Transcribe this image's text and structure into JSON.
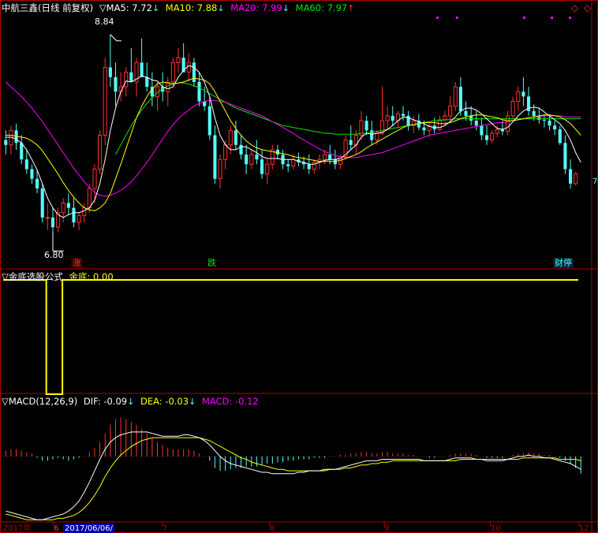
{
  "header": {
    "stock_name": "中航三鑫",
    "period": "(日线 前复权)",
    "ma_indicator": "▽MA5: 7.72",
    "ma5_arrow": "↓",
    "ma10": "MA10: 7.88",
    "ma10_arrow": "↓",
    "ma20": "MA20: 7.99",
    "ma20_arrow": "↓",
    "ma60": "MA60: 7.97",
    "ma60_arrow": "↑"
  },
  "indicator_panel": {
    "title": "▽金底选股公式",
    "label": "金底: 0.00"
  },
  "macd_panel": {
    "title": "▽MACD(12,26,9)",
    "dif": "DIF: -0.09",
    "dif_arrow": "↓",
    "dea": "DEA: -0.03",
    "dea_arrow": "↓",
    "macd": "MACD: -0.12"
  },
  "annotations": {
    "high_label": "8.84",
    "low_label": "6.80",
    "tag_rise": "涨",
    "tag_fall": "跌",
    "tag_finance": "财停"
  },
  "axis": {
    "x_labels": [
      "2017年",
      "6",
      "2017/06/06/",
      "7",
      "8",
      "9",
      "10",
      "12"
    ],
    "right_marker": "7"
  },
  "colors": {
    "up": "#ff3232",
    "down": "#54fcfc",
    "ma5": "#ffffff",
    "ma10": "#ffff00",
    "ma20": "#ff00ff",
    "ma60": "#00e600",
    "dif": "#ffffff",
    "dea": "#ffff00",
    "grid": "#b00000"
  },
  "chart_data": {
    "type": "candlestick",
    "price_range": [
      6.55,
      9.05
    ],
    "candles": [
      [
        7.75,
        7.85,
        7.6,
        7.7
      ],
      [
        7.7,
        7.9,
        7.6,
        7.85
      ],
      [
        7.85,
        7.92,
        7.65,
        7.72
      ],
      [
        7.72,
        7.8,
        7.5,
        7.55
      ],
      [
        7.55,
        7.65,
        7.4,
        7.45
      ],
      [
        7.45,
        7.5,
        7.3,
        7.35
      ],
      [
        7.35,
        7.45,
        7.2,
        7.25
      ],
      [
        7.25,
        7.3,
        6.9,
        6.95
      ],
      [
        6.95,
        7.1,
        6.82,
        6.95
      ],
      [
        6.95,
        7.05,
        6.8,
        6.85
      ],
      [
        6.85,
        7.05,
        6.8,
        7.0
      ],
      [
        7.0,
        7.15,
        6.9,
        7.1
      ],
      [
        7.1,
        7.2,
        6.98,
        7.05
      ],
      [
        7.05,
        7.15,
        6.85,
        6.9
      ],
      [
        6.9,
        7.0,
        6.82,
        6.97
      ],
      [
        6.97,
        7.1,
        6.9,
        7.05
      ],
      [
        7.05,
        7.3,
        7.0,
        7.25
      ],
      [
        7.25,
        7.5,
        7.1,
        7.45
      ],
      [
        7.45,
        7.85,
        7.4,
        7.8
      ],
      [
        7.8,
        8.6,
        7.7,
        8.5
      ],
      [
        8.5,
        8.84,
        8.3,
        8.4
      ],
      [
        8.4,
        8.55,
        8.1,
        8.25
      ],
      [
        8.25,
        8.45,
        8.15,
        8.3
      ],
      [
        8.3,
        8.5,
        8.2,
        8.45
      ],
      [
        8.45,
        8.7,
        8.4,
        8.35
      ],
      [
        8.35,
        8.6,
        8.2,
        8.55
      ],
      [
        8.55,
        8.8,
        8.45,
        8.4
      ],
      [
        8.4,
        8.55,
        8.25,
        8.3
      ],
      [
        8.3,
        8.45,
        8.1,
        8.2
      ],
      [
        8.2,
        8.35,
        8.05,
        8.3
      ],
      [
        8.3,
        8.45,
        8.15,
        8.25
      ],
      [
        8.25,
        8.4,
        8.1,
        8.35
      ],
      [
        8.35,
        8.6,
        8.3,
        8.55
      ],
      [
        8.55,
        8.7,
        8.45,
        8.6
      ],
      [
        8.6,
        8.75,
        8.5,
        8.45
      ],
      [
        8.45,
        8.65,
        8.35,
        8.55
      ],
      [
        8.55,
        8.6,
        8.3,
        8.35
      ],
      [
        8.35,
        8.45,
        8.1,
        8.15
      ],
      [
        8.15,
        8.3,
        8.05,
        8.1
      ],
      [
        8.1,
        8.2,
        7.75,
        7.8
      ],
      [
        7.8,
        7.9,
        7.3,
        7.35
      ],
      [
        7.35,
        7.6,
        7.25,
        7.55
      ],
      [
        7.55,
        7.75,
        7.45,
        7.7
      ],
      [
        7.7,
        7.9,
        7.6,
        7.85
      ],
      [
        7.85,
        7.95,
        7.65,
        7.7
      ],
      [
        7.7,
        7.8,
        7.55,
        7.6
      ],
      [
        7.6,
        7.7,
        7.4,
        7.5
      ],
      [
        7.5,
        7.65,
        7.45,
        7.6
      ],
      [
        7.6,
        7.75,
        7.5,
        7.55
      ],
      [
        7.55,
        7.65,
        7.35,
        7.4
      ],
      [
        7.4,
        7.55,
        7.3,
        7.5
      ],
      [
        7.5,
        7.7,
        7.45,
        7.65
      ],
      [
        7.65,
        7.7,
        7.55,
        7.6
      ],
      [
        7.6,
        7.65,
        7.45,
        7.5
      ],
      [
        7.5,
        7.55,
        7.42,
        7.48
      ],
      [
        7.48,
        7.6,
        7.45,
        7.55
      ],
      [
        7.55,
        7.62,
        7.48,
        7.52
      ],
      [
        7.52,
        7.58,
        7.45,
        7.5
      ],
      [
        7.5,
        7.6,
        7.4,
        7.45
      ],
      [
        7.45,
        7.55,
        7.4,
        7.52
      ],
      [
        7.52,
        7.6,
        7.45,
        7.55
      ],
      [
        7.55,
        7.65,
        7.5,
        7.6
      ],
      [
        7.6,
        7.7,
        7.5,
        7.55
      ],
      [
        7.55,
        7.65,
        7.45,
        7.5
      ],
      [
        7.5,
        7.6,
        7.45,
        7.58
      ],
      [
        7.58,
        7.8,
        7.55,
        7.75
      ],
      [
        7.75,
        7.9,
        7.65,
        7.7
      ],
      [
        7.7,
        7.85,
        7.6,
        7.8
      ],
      [
        7.8,
        8.05,
        7.75,
        7.95
      ],
      [
        7.95,
        8.0,
        7.8,
        7.85
      ],
      [
        7.85,
        7.95,
        7.7,
        7.75
      ],
      [
        7.75,
        7.85,
        7.7,
        7.82
      ],
      [
        7.82,
        8.3,
        7.8,
        7.95
      ],
      [
        7.95,
        8.1,
        7.85,
        8.0
      ],
      [
        8.0,
        8.1,
        7.9,
        7.95
      ],
      [
        7.95,
        8.05,
        7.88,
        8.02
      ],
      [
        8.02,
        8.1,
        7.95,
        8.0
      ],
      [
        8.0,
        8.05,
        7.85,
        7.9
      ],
      [
        7.9,
        8.0,
        7.82,
        7.95
      ],
      [
        7.95,
        8.02,
        7.85,
        7.88
      ],
      [
        7.88,
        7.95,
        7.8,
        7.85
      ],
      [
        7.85,
        7.92,
        7.78,
        7.9
      ],
      [
        7.9,
        7.98,
        7.82,
        7.86
      ],
      [
        7.86,
        8.0,
        7.84,
        7.96
      ],
      [
        7.96,
        8.05,
        7.9,
        8.0
      ],
      [
        8.0,
        8.2,
        7.95,
        8.1
      ],
      [
        8.1,
        8.35,
        8.05,
        8.3
      ],
      [
        8.3,
        8.4,
        8.0,
        8.05
      ],
      [
        8.05,
        8.15,
        7.95,
        8.0
      ],
      [
        8.0,
        8.1,
        7.9,
        7.95
      ],
      [
        7.95,
        8.05,
        7.85,
        7.9
      ],
      [
        7.9,
        7.98,
        7.75,
        7.8
      ],
      [
        7.8,
        7.9,
        7.7,
        7.75
      ],
      [
        7.75,
        7.85,
        7.72,
        7.82
      ],
      [
        7.82,
        7.9,
        7.78,
        7.86
      ],
      [
        7.86,
        7.95,
        7.8,
        7.84
      ],
      [
        7.84,
        8.05,
        7.8,
        8.0
      ],
      [
        8.0,
        8.2,
        7.95,
        8.15
      ],
      [
        8.15,
        8.3,
        8.05,
        8.25
      ],
      [
        8.25,
        8.4,
        8.1,
        8.2
      ],
      [
        8.2,
        8.3,
        8.0,
        8.05
      ],
      [
        8.05,
        8.12,
        7.95,
        8.0
      ],
      [
        8.0,
        8.08,
        7.92,
        7.96
      ],
      [
        7.96,
        8.02,
        7.88,
        7.95
      ],
      [
        7.95,
        8.0,
        7.85,
        7.9
      ],
      [
        7.9,
        7.95,
        7.8,
        7.86
      ],
      [
        7.86,
        7.9,
        7.7,
        7.72
      ],
      [
        7.72,
        7.8,
        7.4,
        7.45
      ],
      [
        7.45,
        7.55,
        7.25,
        7.3
      ],
      [
        7.3,
        7.42,
        7.28,
        7.4
      ]
    ],
    "ma5": [
      7.78,
      7.78,
      7.76,
      7.72,
      7.65,
      7.55,
      7.44,
      7.3,
      7.15,
      7.05,
      6.98,
      6.95,
      6.98,
      7.0,
      7.0,
      7.02,
      7.05,
      7.13,
      7.3,
      7.55,
      7.85,
      8.08,
      8.25,
      8.36,
      8.35,
      8.38,
      8.41,
      8.4,
      8.37,
      8.36,
      8.3,
      8.28,
      8.3,
      8.4,
      8.47,
      8.52,
      8.5,
      8.45,
      8.35,
      8.2,
      7.98,
      7.8,
      7.7,
      7.65,
      7.65,
      7.68,
      7.68,
      7.65,
      7.62,
      7.58,
      7.56,
      7.56,
      7.56,
      7.55,
      7.55,
      7.55,
      7.53,
      7.52,
      7.5,
      7.5,
      7.52,
      7.54,
      7.55,
      7.55,
      7.56,
      7.6,
      7.65,
      7.7,
      7.78,
      7.82,
      7.81,
      7.82,
      7.83,
      7.86,
      7.9,
      7.95,
      7.99,
      7.98,
      7.96,
      7.94,
      7.92,
      7.89,
      7.88,
      7.88,
      7.9,
      7.94,
      7.99,
      8.05,
      8.08,
      8.08,
      8.06,
      8.02,
      7.97,
      7.92,
      7.87,
      7.86,
      7.88,
      7.94,
      8.0,
      8.05,
      8.08,
      8.09,
      8.08,
      8.04,
      8.0,
      7.96,
      7.92,
      7.85,
      7.75,
      7.62,
      7.52
    ],
    "ma10": [
      7.8,
      7.8,
      7.79,
      7.78,
      7.77,
      7.74,
      7.7,
      7.64,
      7.56,
      7.48,
      7.4,
      7.31,
      7.23,
      7.16,
      7.1,
      7.05,
      7.03,
      7.02,
      7.05,
      7.1,
      7.2,
      7.35,
      7.5,
      7.66,
      7.82,
      7.98,
      8.1,
      8.2,
      8.28,
      8.33,
      8.35,
      8.34,
      8.33,
      8.34,
      8.35,
      8.37,
      8.39,
      8.38,
      8.37,
      8.33,
      8.25,
      8.15,
      8.05,
      7.95,
      7.87,
      7.8,
      7.74,
      7.7,
      7.67,
      7.65,
      7.64,
      7.63,
      7.62,
      7.61,
      7.6,
      7.58,
      7.57,
      7.56,
      7.55,
      7.54,
      7.53,
      7.53,
      7.53,
      7.53,
      7.54,
      7.56,
      7.58,
      7.6,
      7.63,
      7.67,
      7.7,
      7.73,
      7.76,
      7.79,
      7.82,
      7.85,
      7.88,
      7.9,
      7.91,
      7.92,
      7.93,
      7.93,
      7.93,
      7.92,
      7.92,
      7.93,
      7.95,
      7.97,
      7.99,
      8.0,
      8.01,
      8.01,
      8.0,
      7.99,
      7.98,
      7.96,
      7.95,
      7.95,
      7.96,
      7.97,
      7.98,
      7.99,
      8.0,
      8.01,
      8.01,
      8.0,
      7.99,
      7.96,
      7.92,
      7.86,
      7.8
    ],
    "ma20": [
      8.35,
      8.3,
      8.25,
      8.2,
      8.14,
      8.08,
      8.01,
      7.94,
      7.86,
      7.78,
      7.7,
      7.62,
      7.54,
      7.46,
      7.39,
      7.32,
      7.26,
      7.21,
      7.18,
      7.17,
      7.18,
      7.2,
      7.23,
      7.27,
      7.32,
      7.38,
      7.45,
      7.52,
      7.6,
      7.68,
      7.76,
      7.84,
      7.91,
      7.97,
      8.02,
      8.06,
      8.1,
      8.13,
      8.15,
      8.16,
      8.16,
      8.15,
      8.14,
      8.12,
      8.1,
      8.08,
      8.06,
      8.04,
      8.02,
      8.0,
      7.97,
      7.94,
      7.91,
      7.88,
      7.85,
      7.82,
      7.78,
      7.75,
      7.72,
      7.69,
      7.66,
      7.63,
      7.61,
      7.59,
      7.58,
      7.57,
      7.57,
      7.57,
      7.58,
      7.59,
      7.6,
      7.61,
      7.62,
      7.64,
      7.66,
      7.68,
      7.7,
      7.72,
      7.74,
      7.76,
      7.78,
      7.8,
      7.81,
      7.82,
      7.83,
      7.84,
      7.85,
      7.86,
      7.87,
      7.88,
      7.89,
      7.9,
      7.91,
      7.92,
      7.93,
      7.93,
      7.94,
      7.95,
      7.96,
      7.97,
      7.98,
      7.99,
      7.99,
      8.0,
      8.0,
      8.0,
      8.0,
      7.99,
      7.99,
      7.99,
      7.99
    ],
    "ma60": [
      null,
      null,
      null,
      null,
      null,
      null,
      null,
      null,
      null,
      null,
      null,
      null,
      null,
      null,
      null,
      null,
      null,
      null,
      null,
      null,
      null,
      7.6,
      7.7,
      7.8,
      7.9,
      7.98,
      8.06,
      8.13,
      8.19,
      8.24,
      8.28,
      8.31,
      8.33,
      8.34,
      8.34,
      8.33,
      8.31,
      8.29,
      8.26,
      8.23,
      8.2,
      8.17,
      8.14,
      8.11,
      8.08,
      8.06,
      8.04,
      8.02,
      8.0,
      7.98,
      7.96,
      7.94,
      7.92,
      7.9,
      7.89,
      7.88,
      7.87,
      7.86,
      7.85,
      7.84,
      7.83,
      7.82,
      7.82,
      7.81,
      7.81,
      7.81,
      7.81,
      7.81,
      7.82,
      7.82,
      7.83,
      7.84,
      7.85,
      7.86,
      7.87,
      7.88,
      7.89,
      7.9,
      7.91,
      7.92,
      7.93,
      7.94,
      7.95,
      7.95,
      7.96,
      7.96,
      7.97,
      7.97,
      7.97,
      7.97,
      7.97,
      7.97,
      7.97,
      7.97,
      7.97,
      7.97,
      7.97,
      7.97,
      7.97,
      7.97,
      7.97,
      7.97,
      7.97,
      7.97,
      7.97,
      7.97,
      7.97,
      7.97,
      7.97,
      7.97,
      7.97
    ],
    "jindi": {
      "range": [
        0,
        1
      ],
      "values_by_fraction": [
        [
          0,
          1
        ],
        [
          0.075,
          1
        ],
        [
          0.075,
          0
        ],
        [
          0.103,
          0
        ],
        [
          0.103,
          1
        ],
        [
          1.0,
          1
        ]
      ]
    },
    "macd": {
      "range": [
        -0.45,
        0.35
      ],
      "hist": [
        0.04,
        0.05,
        0.05,
        0.04,
        0.03,
        0.02,
        -0.01,
        -0.03,
        -0.03,
        -0.02,
        -0.01,
        -0.02,
        -0.03,
        -0.02,
        -0.01,
        0.0,
        0.03,
        0.06,
        0.1,
        0.16,
        0.22,
        0.26,
        0.27,
        0.26,
        0.24,
        0.22,
        0.19,
        0.16,
        0.13,
        0.1,
        0.08,
        0.06,
        0.05,
        0.05,
        0.05,
        0.05,
        0.04,
        0.02,
        0.0,
        -0.03,
        -0.08,
        -0.1,
        -0.1,
        -0.09,
        -0.08,
        -0.08,
        -0.07,
        -0.07,
        -0.07,
        -0.06,
        -0.05,
        -0.05,
        -0.04,
        -0.04,
        -0.03,
        -0.03,
        -0.02,
        -0.02,
        -0.02,
        -0.01,
        -0.01,
        -0.01,
        0.0,
        0.0,
        0.01,
        0.01,
        0.02,
        0.02,
        0.03,
        0.03,
        0.02,
        0.02,
        0.03,
        0.03,
        0.02,
        0.02,
        0.02,
        0.01,
        0.01,
        0.0,
        0.0,
        -0.01,
        -0.01,
        0.0,
        0.0,
        0.01,
        0.02,
        0.02,
        0.02,
        0.02,
        0.01,
        0.0,
        -0.01,
        -0.01,
        -0.01,
        -0.01,
        0.0,
        0.01,
        0.02,
        0.02,
        0.03,
        0.02,
        0.02,
        0.01,
        0.01,
        0.0,
        -0.01,
        -0.03,
        -0.05,
        -0.08,
        -0.12
      ],
      "dif": [
        -0.38,
        -0.39,
        -0.4,
        -0.41,
        -0.42,
        -0.43,
        -0.44,
        -0.44,
        -0.43,
        -0.42,
        -0.41,
        -0.4,
        -0.38,
        -0.35,
        -0.31,
        -0.25,
        -0.18,
        -0.1,
        -0.02,
        0.05,
        0.1,
        0.13,
        0.15,
        0.16,
        0.17,
        0.17,
        0.17,
        0.17,
        0.16,
        0.15,
        0.14,
        0.14,
        0.14,
        0.14,
        0.15,
        0.15,
        0.14,
        0.13,
        0.11,
        0.08,
        0.04,
        0.0,
        -0.03,
        -0.05,
        -0.06,
        -0.07,
        -0.08,
        -0.09,
        -0.1,
        -0.11,
        -0.11,
        -0.12,
        -0.12,
        -0.12,
        -0.12,
        -0.12,
        -0.11,
        -0.11,
        -0.1,
        -0.1,
        -0.1,
        -0.09,
        -0.09,
        -0.09,
        -0.08,
        -0.07,
        -0.06,
        -0.05,
        -0.04,
        -0.03,
        -0.03,
        -0.03,
        -0.02,
        -0.02,
        -0.02,
        -0.02,
        -0.02,
        -0.02,
        -0.02,
        -0.02,
        -0.03,
        -0.03,
        -0.03,
        -0.03,
        -0.03,
        -0.02,
        -0.01,
        -0.01,
        -0.01,
        -0.01,
        -0.02,
        -0.02,
        -0.03,
        -0.03,
        -0.03,
        -0.03,
        -0.02,
        -0.01,
        0.0,
        0.0,
        0.01,
        0.0,
        0.0,
        -0.01,
        -0.01,
        -0.02,
        -0.03,
        -0.04,
        -0.05,
        -0.07,
        -0.09
      ],
      "dea": [
        -0.4,
        -0.41,
        -0.42,
        -0.43,
        -0.44,
        -0.44,
        -0.44,
        -0.44,
        -0.44,
        -0.44,
        -0.43,
        -0.43,
        -0.42,
        -0.41,
        -0.39,
        -0.36,
        -0.32,
        -0.27,
        -0.21,
        -0.14,
        -0.08,
        -0.03,
        0.01,
        0.04,
        0.07,
        0.09,
        0.11,
        0.12,
        0.13,
        0.13,
        0.13,
        0.13,
        0.13,
        0.13,
        0.13,
        0.13,
        0.13,
        0.13,
        0.12,
        0.11,
        0.09,
        0.07,
        0.05,
        0.03,
        0.01,
        -0.01,
        -0.02,
        -0.04,
        -0.05,
        -0.06,
        -0.07,
        -0.08,
        -0.09,
        -0.09,
        -0.1,
        -0.1,
        -0.1,
        -0.1,
        -0.1,
        -0.1,
        -0.1,
        -0.1,
        -0.09,
        -0.09,
        -0.09,
        -0.08,
        -0.08,
        -0.07,
        -0.06,
        -0.06,
        -0.05,
        -0.05,
        -0.04,
        -0.04,
        -0.03,
        -0.03,
        -0.03,
        -0.03,
        -0.03,
        -0.03,
        -0.03,
        -0.03,
        -0.03,
        -0.03,
        -0.03,
        -0.03,
        -0.03,
        -0.02,
        -0.02,
        -0.02,
        -0.02,
        -0.02,
        -0.02,
        -0.02,
        -0.02,
        -0.02,
        -0.02,
        -0.02,
        -0.02,
        -0.01,
        -0.01,
        -0.01,
        -0.01,
        -0.01,
        -0.01,
        -0.01,
        -0.02,
        -0.02,
        -0.02,
        -0.02,
        -0.03
      ]
    }
  }
}
